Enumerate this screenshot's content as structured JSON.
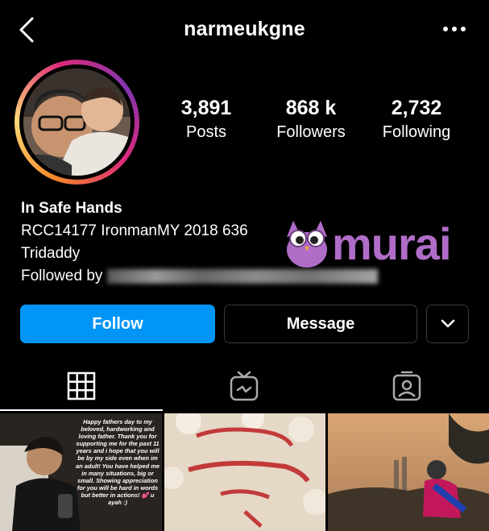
{
  "header": {
    "username": "narmeukgne",
    "back_icon": "chevron-left-icon",
    "more_icon": "ellipsis-icon"
  },
  "stats": [
    {
      "value": "3,891",
      "label": "Posts"
    },
    {
      "value": "868 k",
      "label": "Followers"
    },
    {
      "value": "2,732",
      "label": "Following"
    }
  ],
  "bio": {
    "name": "In Safe Hands",
    "line1": "RCC14177 IronmanMY 2018 636",
    "line2": "Tridaddy",
    "followed_by_prefix": "Followed by"
  },
  "watermark": {
    "text": "murai"
  },
  "actions": {
    "follow_label": "Follow",
    "message_label": "Message",
    "more_icon": "chevron-down-icon"
  },
  "tabs": [
    {
      "name": "posts-grid",
      "icon": "grid-icon",
      "active": true
    },
    {
      "name": "igtv",
      "icon": "igtv-icon",
      "active": false
    },
    {
      "name": "tagged",
      "icon": "tagged-person-icon",
      "active": false
    }
  ],
  "posts": [
    {
      "caption": "Happy fathers day to my beloved, hardworking and loving father. Thank you for supporting me for the past 11 years and i hope that you will be by my side even when im an adult! You have helped me in many situations, big or small. Showing appreciation for you will be hard in words but better in actions! 💕 u ayah :)"
    },
    {
      "caption": ""
    },
    {
      "caption": ""
    }
  ],
  "colors": {
    "background": "#000000",
    "follow_button": "#0095f6",
    "secondary_border": "#3a3a3a",
    "watermark": "#b06dc8"
  }
}
